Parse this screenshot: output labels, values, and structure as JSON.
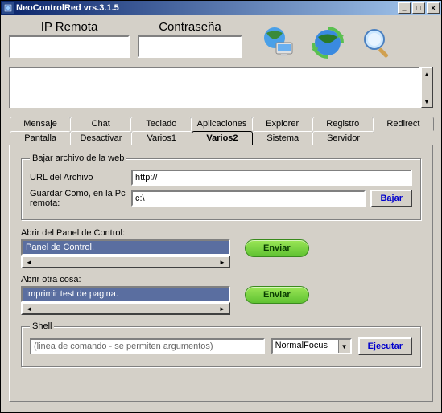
{
  "window": {
    "title": "NeoControlRed vrs.3.1.5",
    "min_symbol": "_",
    "max_symbol": "□",
    "close_symbol": "×"
  },
  "header": {
    "ip_label": "IP Remota",
    "pw_label": "Contraseña",
    "ip_value": "",
    "pw_value": ""
  },
  "icons": {
    "globe_monitor": "globe-monitor-icon",
    "globe_arrow": "globe-refresh-icon",
    "magnifier": "magnifier-icon"
  },
  "log_value": "",
  "tabs_row1": [
    "Mensaje",
    "Chat",
    "Teclado",
    "Aplicaciones",
    "Explorer",
    "Registro",
    "Redirect"
  ],
  "tabs_row2": [
    "Pantalla",
    "Desactivar",
    "Varios1",
    "Varios2",
    "Sistema",
    "Servidor"
  ],
  "active_tab": "Varios2",
  "download": {
    "legend": "Bajar archivo de la web",
    "url_label": "URL del Archivo",
    "url_value": "http://",
    "save_label": "Guardar Como, en la Pc remota:",
    "save_value": "c:\\",
    "button": "Bajar"
  },
  "panel1": {
    "label": "Abrir del Panel de Control:",
    "item": "Panel de Control.",
    "button": "Enviar"
  },
  "panel2": {
    "label": "Abrir otra cosa:",
    "item": "Imprimir test de pagina.",
    "button": "Enviar"
  },
  "shell": {
    "legend": "Shell",
    "placeholder": "(linea de comando - se permiten argumentos)",
    "focus_value": "NormalFocus",
    "button": "Ejecutar"
  },
  "arrows": {
    "up": "▲",
    "down": "▼",
    "left": "◄",
    "right": "►"
  }
}
